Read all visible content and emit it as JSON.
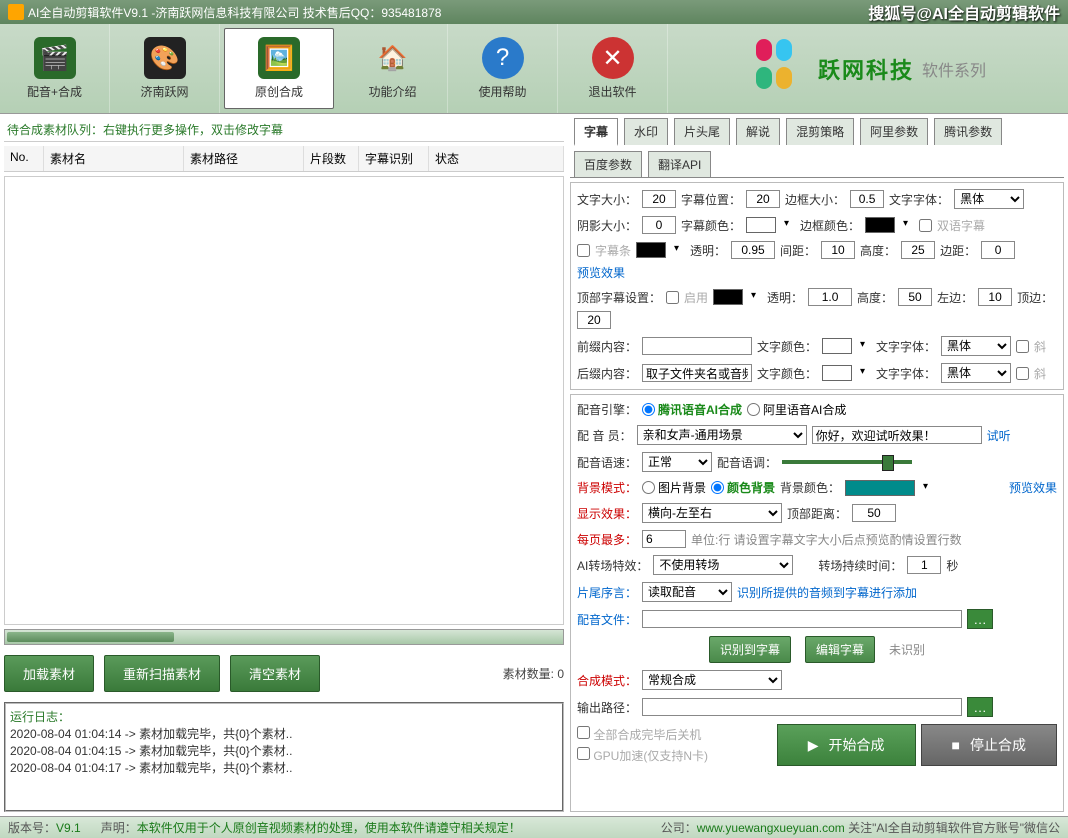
{
  "window": {
    "title": "AI全自动剪辑软件V9.1 -济南跃网信息科技有限公司 技术售后QQ：935481878",
    "brand_tag": "搜狐号@AI全自动剪辑软件"
  },
  "toolbar": {
    "items": [
      {
        "label": "配音+合成"
      },
      {
        "label": "济南跃网"
      },
      {
        "label": "原创合成"
      },
      {
        "label": "功能介绍"
      },
      {
        "label": "使用帮助"
      },
      {
        "label": "退出软件"
      }
    ],
    "brand_main": "跃网科技",
    "brand_sub": "软件系列"
  },
  "queue": {
    "hint": "待合成素材队列：右键执行更多操作，双击修改字幕",
    "cols": [
      "No.",
      "素材名",
      "素材路径",
      "片段数",
      "字幕识别",
      "状态"
    ],
    "buttons": {
      "load": "加载素材",
      "rescan": "重新扫描素材",
      "clear": "清空素材"
    },
    "count_label": "素材数量:",
    "count_value": "0"
  },
  "log": {
    "title": "运行日志：",
    "lines": [
      "2020-08-04 01:04:14 -> 素材加载完毕，共{0}个素材..",
      "2020-08-04 01:04:15 -> 素材加载完毕，共{0}个素材..",
      "2020-08-04 01:04:17 -> 素材加载完毕，共{0}个素材.."
    ]
  },
  "tabs": [
    "字幕",
    "水印",
    "片头尾",
    "解说",
    "混剪策略",
    "阿里参数",
    "腾讯参数",
    "百度参数",
    "翻译API"
  ],
  "subtitle": {
    "font_size_l": "文字大小：",
    "font_size": "20",
    "pos_l": "字幕位置：",
    "pos": "20",
    "border_l": "边框大小：",
    "border": "0.5",
    "font_l": "文字字体：",
    "font": "黑体",
    "shadow_l": "阴影大小：",
    "shadow": "0",
    "color_l": "字幕颜色：",
    "border_color_l": "边框颜色：",
    "bilingual": "双语字幕",
    "bar_l": "字幕条",
    "trans_l": "透明：",
    "trans": "0.95",
    "gap_l": "间距：",
    "gap": "10",
    "h_l": "高度：",
    "h": "25",
    "margin_l": "边距：",
    "margin": "0",
    "preview": "预览效果",
    "top_set_l": "顶部字幕设置：",
    "enable": "启用",
    "trans2": "1.0",
    "h2": "50",
    "left_l": "左边：",
    "left": "10",
    "top_l": "顶边：",
    "top": "20",
    "prefix_l": "前缀内容：",
    "text_color_l": "文字颜色：",
    "italic": "斜",
    "suffix_l": "后缀内容：",
    "suffix_val": "取子文件夹名或音频",
    "font2": "黑体"
  },
  "voice": {
    "engine_l": "配音引擎：",
    "engine1": "腾讯语音AI合成",
    "engine2": "阿里语音AI合成",
    "member_l": "配 音 员：",
    "member": "亲和女声-通用场景",
    "sample": "你好，欢迎试听效果！",
    "try": "试听",
    "speed_l": "配音语速：",
    "speed": "正常",
    "tone_l": "配音语调：",
    "bg_mode_l": "背景模式：",
    "bg_img": "图片背景",
    "bg_color": "颜色背景",
    "bg_color_l": "背景颜色：",
    "preview": "预览效果",
    "display_l": "显示效果：",
    "display": "横向-左至右",
    "top_dist_l": "顶部距离：",
    "top_dist": "50",
    "per_page_l": "每页最多：",
    "per_page": "6",
    "per_page_hint": "单位:行 请设置字幕文字大小后点预览酌情设置行数",
    "ai_trans_l": "AI转场特效：",
    "ai_trans": "不使用转场",
    "trans_dur_l": "转场持续时间：",
    "trans_dur": "1",
    "sec": "秒",
    "tail_l": "片尾序言：",
    "tail_val": "读取配音",
    "tail_hint": "识别所提供的音频到字幕进行添加",
    "file_l": "配音文件：",
    "rec_btn": "识别到字幕",
    "edit_btn": "编辑字幕",
    "unrec": "未识别",
    "mode_l": "合成模式：",
    "mode": "常规合成",
    "out_l": "输出路径："
  },
  "final": {
    "shutdown": "全部合成完毕后关机",
    "gpu": "GPU加速(仅支持N卡)",
    "start": "开始合成",
    "stop": "停止合成"
  },
  "status": {
    "ver_l": "版本号：",
    "ver": "V9.1",
    "disclaimer_l": "声明：",
    "disclaimer": "本软件仅用于个人原创音视频素材的处理，使用本软件请遵守相关规定！",
    "site_l": "公司：",
    "site": "www.yuewangxueyuan.com",
    "follow": "关注\"AI全自动剪辑软件官方账号\"微信公"
  },
  "colors": {
    "black": "#000000",
    "white": "#ffffff",
    "teal": "#008b8b"
  }
}
